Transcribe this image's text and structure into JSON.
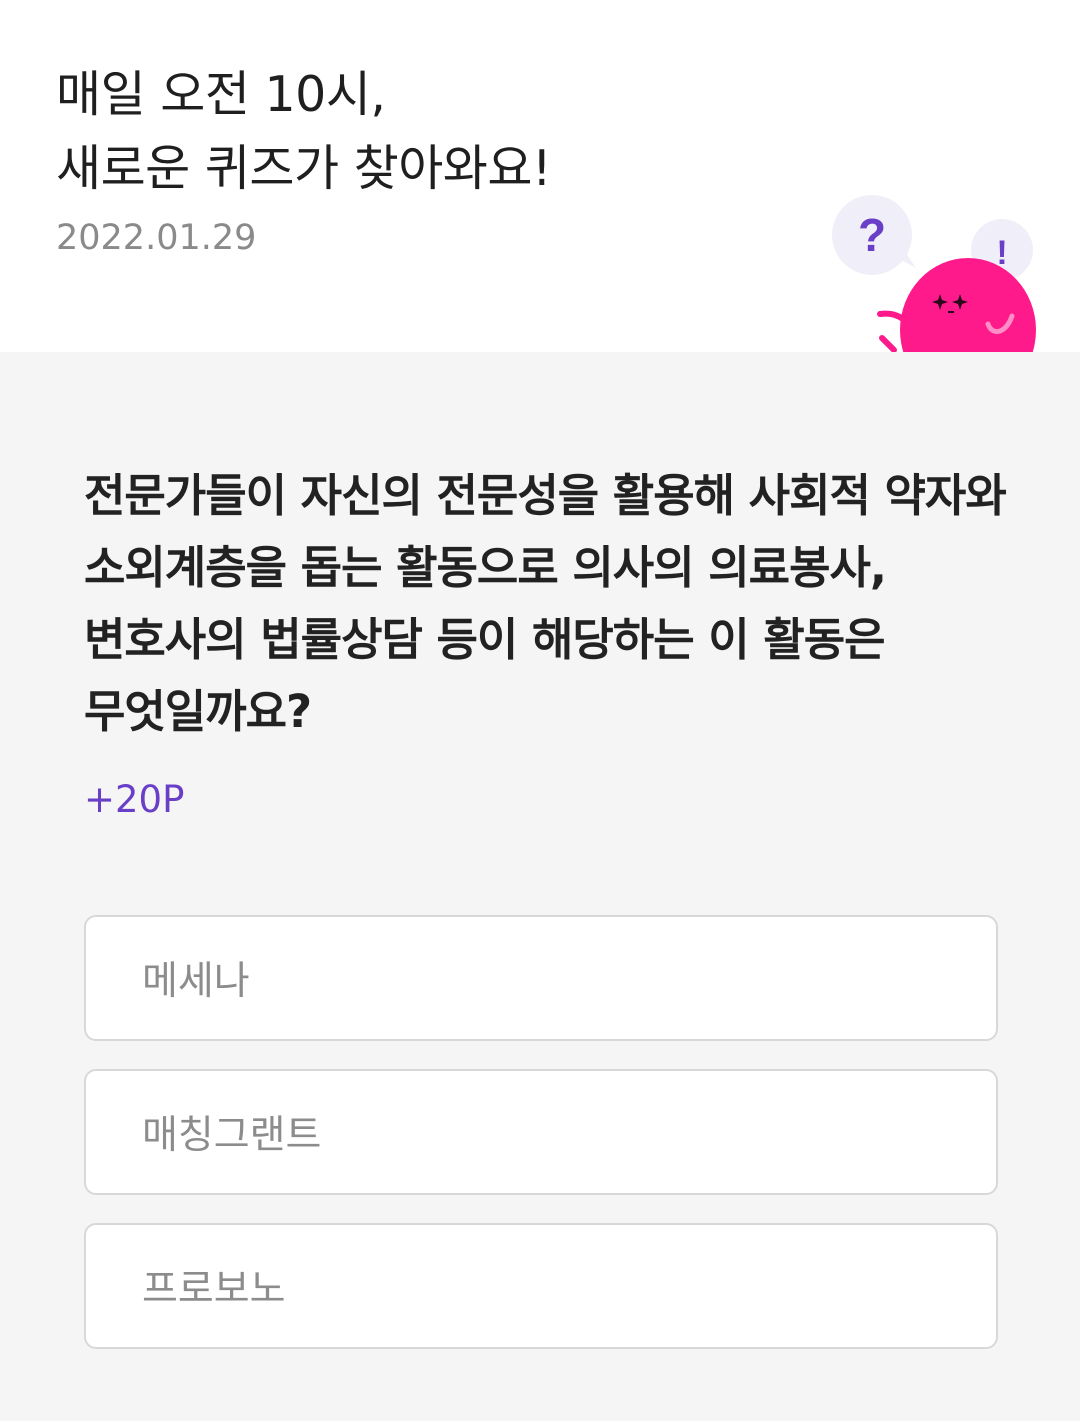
{
  "header": {
    "headline_line1": "매일 오전 10시,",
    "headline_line2": "새로운 퀴즈가 찾아와요!",
    "date": "2022.01.29",
    "mascot": {
      "question_mark": "?",
      "exclamation_mark": "!",
      "body_color": "#ff1a8c",
      "bubble_color": "#f0eef8",
      "accent_color": "#6a3fc7"
    }
  },
  "quiz": {
    "question": "전문가들이 자신의 전문성을 활용해 사회적 약자와 소외계층을 돕는 활동으로 의사의 의료봉사, 변호사의 법률상담 등이 해당하는 이 활동은 무엇일까요?",
    "points": "+20P",
    "options": [
      {
        "label": "메세나"
      },
      {
        "label": "매칭그랜트"
      },
      {
        "label": "프로보노"
      }
    ]
  },
  "colors": {
    "background": "#f5f5f5",
    "card": "#ffffff",
    "accent": "#6a3fc7",
    "mascot_pink": "#ff1a8c"
  }
}
